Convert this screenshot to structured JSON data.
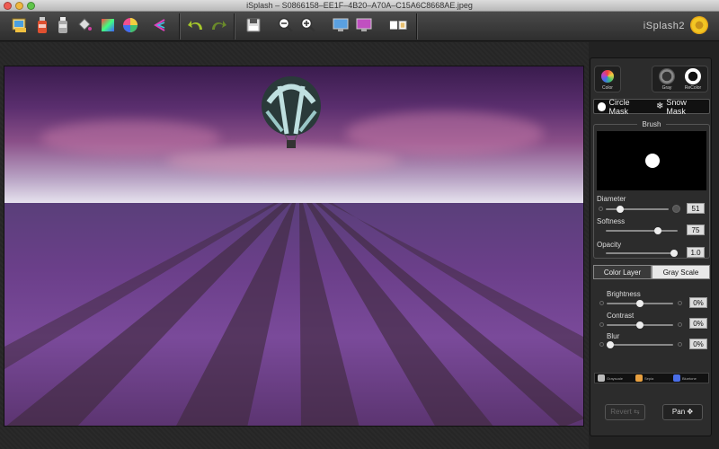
{
  "window": {
    "title": "iSplash – S0866158–EE1F–4B20–A70A–C15A6C8668AE.jpeg"
  },
  "toolbar": {
    "tools": [
      {
        "name": "open-image-icon",
        "glyph": "🖼",
        "color": "#f0c040"
      },
      {
        "name": "red-bottle-icon",
        "glyph": "🧴",
        "color": "#e05030"
      },
      {
        "name": "gray-bottle-icon",
        "glyph": "🧴",
        "color": "#aaaaaa"
      },
      {
        "name": "paint-bucket-icon",
        "glyph": "🪣",
        "color": "#cccccc"
      },
      {
        "name": "gradient-square-icon",
        "glyph": "■",
        "color": "#7c6cff"
      },
      {
        "name": "color-wheel-icon",
        "glyph": "◉",
        "color": "#ff5fa0"
      },
      {
        "name": "share-icon",
        "glyph": "<",
        "color": "#e040c0"
      }
    ],
    "undo": "↶",
    "redo": "↷",
    "save": "💾",
    "zoom_out": "−",
    "zoom_in": "+",
    "brand": "iSplash2"
  },
  "panel": {
    "modes": {
      "color": "Color",
      "gray": "Gray",
      "recolor": "ReColor"
    },
    "masks": {
      "circle": "Circle Mask",
      "snow": "Snow Mask"
    },
    "brush": {
      "title": "Brush",
      "diameter": {
        "label": "Diameter",
        "value": "51",
        "level": 0.2
      },
      "softness": {
        "label": "Softness",
        "value": "75",
        "level": 0.75
      },
      "opacity": {
        "label": "Opacity",
        "value": "1.0",
        "level": 1.0
      }
    },
    "layers": {
      "color": "Color Layer",
      "gray": "Gray Scale"
    },
    "adjust": {
      "brightness": {
        "label": "Brightness",
        "value": "0%",
        "level": 0.5
      },
      "contrast": {
        "label": "Contrast",
        "value": "0%",
        "level": 0.5
      },
      "blur": {
        "label": "Blur",
        "value": "0%",
        "level": 0.0
      }
    },
    "filters": [
      {
        "label": "Grayscale",
        "color": "#bbbbbb"
      },
      {
        "label": "Sepia",
        "color": "#e8a040"
      },
      {
        "label": "Bluetone",
        "color": "#4a6ee8"
      }
    ],
    "revert": "Revert",
    "pan": "Pan"
  }
}
